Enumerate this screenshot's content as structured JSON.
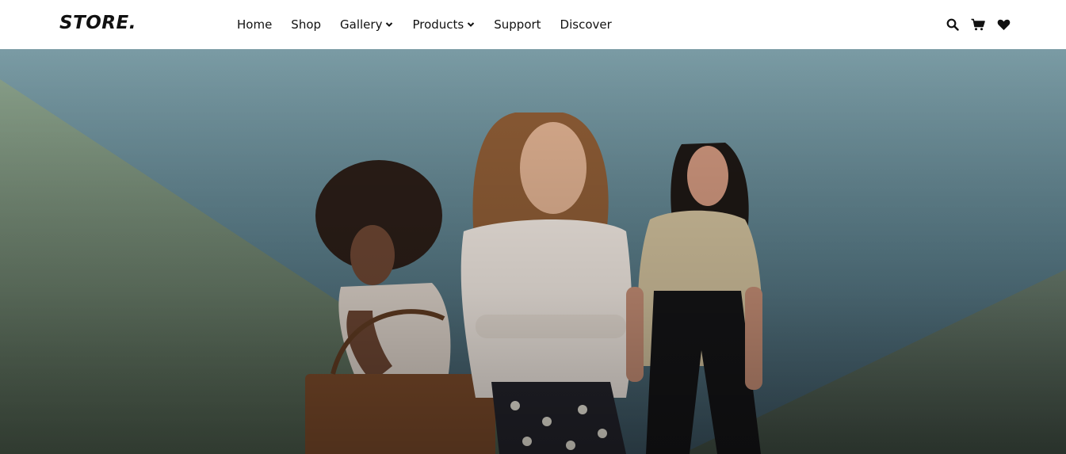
{
  "brand": {
    "logo_text": "STORE."
  },
  "nav": {
    "items": [
      {
        "label": "Home",
        "has_dropdown": false
      },
      {
        "label": "Shop",
        "has_dropdown": false
      },
      {
        "label": "Gallery",
        "has_dropdown": true
      },
      {
        "label": "Products",
        "has_dropdown": true
      },
      {
        "label": "Support",
        "has_dropdown": false
      },
      {
        "label": "Discover",
        "has_dropdown": false
      }
    ]
  },
  "icons": [
    "search-icon",
    "cart-icon",
    "heart-icon"
  ],
  "colors": {
    "nav_bg": "#ffffff",
    "text": "#111111",
    "hero_sky": "#6f93a0",
    "hero_green": "#6b7d6a"
  }
}
